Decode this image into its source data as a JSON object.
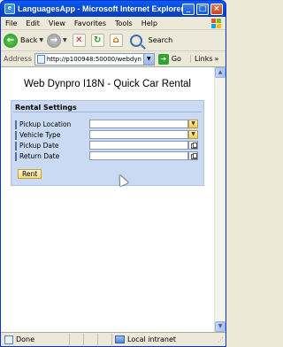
{
  "window": {
    "title": "LanguagesApp - Microsoft Internet Explorer pr...",
    "minimize": "_",
    "maximize": "□",
    "close": "×"
  },
  "menu": [
    "File",
    "Edit",
    "View",
    "Favorites",
    "Tools",
    "Help"
  ],
  "toolbar": {
    "back_label": "Back",
    "search_label": "Search"
  },
  "address": {
    "label": "Address",
    "url": "http://p100948:50000/webdyn",
    "go_label": "Go",
    "links_label": "Links"
  },
  "page": {
    "heading": "Web Dynpro I18N - Quick Car Rental",
    "panel_title": "Rental Settings",
    "fields": [
      {
        "label": "Pickup Location",
        "value": "",
        "kind": "dropdown"
      },
      {
        "label": "Vehicle Type",
        "value": "",
        "kind": "dropdown"
      },
      {
        "label": "Pickup Date",
        "value": "",
        "kind": "date"
      },
      {
        "label": "Return Date",
        "value": "",
        "kind": "date"
      }
    ],
    "rent_button": "Rent"
  },
  "status": {
    "text": "Done",
    "zone": "Local intranet"
  },
  "colors": {
    "panel_bg": "#c9daf2",
    "button_bg": "#f5d978",
    "titlebar": "#0a5cf0"
  }
}
